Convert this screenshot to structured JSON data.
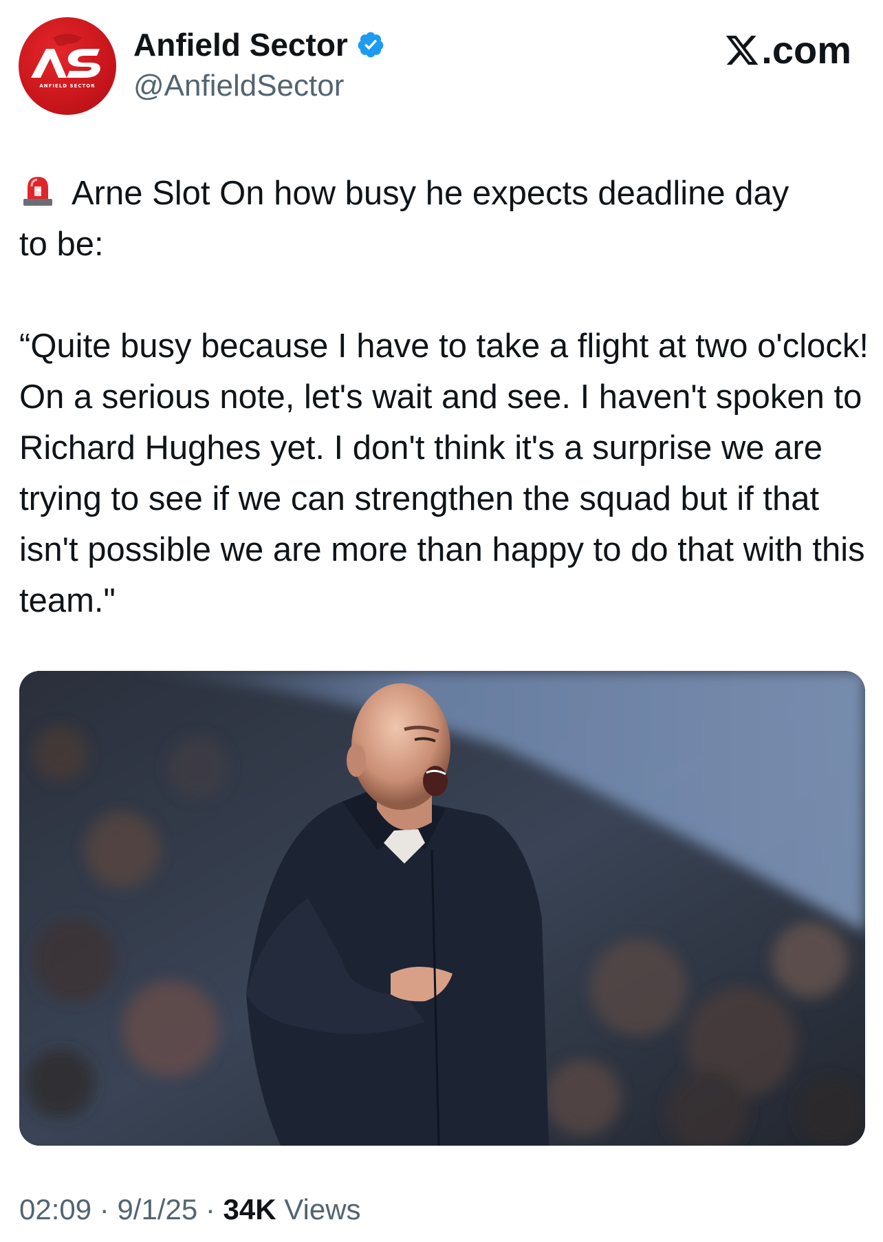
{
  "header": {
    "avatar_text": "ANFIELD SECTOR",
    "avatar_monogram": "AS",
    "display_name": "Anfield Sector",
    "handle": "@AnfieldSector",
    "verified_icon": "verified-badge-icon",
    "brand_suffix": ".com",
    "brand_icon": "x-logo-icon"
  },
  "tweet": {
    "emoji_icon": "police-siren-icon",
    "text": "Arne Slot On how busy he expects deadline day\nto be:\n\n“Quite busy because I have to take a flight at two o'clock! On a serious note, let's wait and see. I haven't spoken to Richard Hughes yet. I don't think it's a surprise we are trying to see if we can strengthen the squad but if that isn't possible we are more than happy to do that with this team.\""
  },
  "media": {
    "description_icon": "photo-icon"
  },
  "meta": {
    "time": "02:09",
    "separator1": " · ",
    "date": "9/1/25",
    "separator2": " · ",
    "views_count": "34K",
    "views_label": " Views"
  },
  "colors": {
    "accent_blue": "#1d9bf0",
    "brand_red": "#c8161c",
    "text_primary": "#0f1419",
    "text_secondary": "#536471"
  }
}
